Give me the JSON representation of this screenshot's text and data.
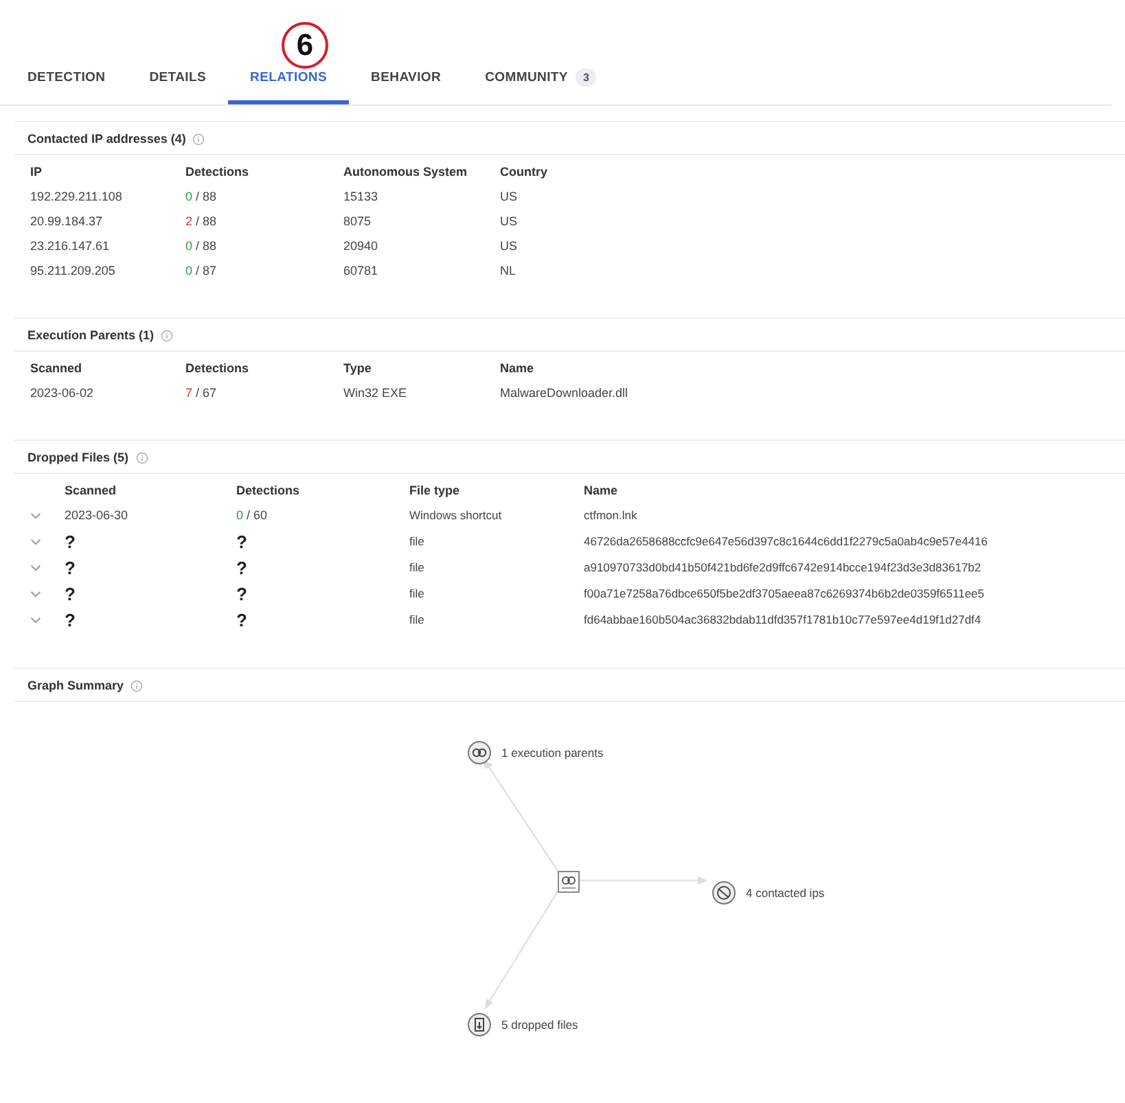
{
  "annotation": {
    "label": "6"
  },
  "tabs": [
    {
      "label": "DETECTION",
      "selected": false
    },
    {
      "label": "DETAILS",
      "selected": false
    },
    {
      "label": "RELATIONS",
      "selected": true
    },
    {
      "label": "BEHAVIOR",
      "selected": false
    },
    {
      "label": "COMMUNITY",
      "selected": false,
      "count": "3"
    }
  ],
  "contacted_ips": {
    "title": "Contacted IP addresses",
    "count": "(4)",
    "columns": [
      "IP",
      "Detections",
      "Autonomous System",
      "Country"
    ],
    "rows": [
      {
        "ip": "192.229.211.108",
        "positives": "0",
        "total": "/ 88",
        "flagged": false,
        "as": "15133",
        "country": "US"
      },
      {
        "ip": "20.99.184.37",
        "positives": "2",
        "total": "/ 88",
        "flagged": true,
        "as": "8075",
        "country": "US"
      },
      {
        "ip": "23.216.147.61",
        "positives": "0",
        "total": "/ 88",
        "flagged": false,
        "as": "20940",
        "country": "US"
      },
      {
        "ip": "95.211.209.205",
        "positives": "0",
        "total": "/ 87",
        "flagged": false,
        "as": "60781",
        "country": "NL"
      }
    ]
  },
  "execution_parents": {
    "title": "Execution Parents",
    "count": "(1)",
    "columns": [
      "Scanned",
      "Detections",
      "Type",
      "Name"
    ],
    "rows": [
      {
        "scanned": "2023-06-02",
        "positives": "7",
        "total": "/ 67",
        "flagged": true,
        "type": "Win32 EXE",
        "name": "MalwareDownloader.dll"
      }
    ]
  },
  "dropped_files": {
    "title": "Dropped Files",
    "count": "(5)",
    "columns": [
      "Scanned",
      "Detections",
      "File type",
      "Name"
    ],
    "rows": [
      {
        "kind": "known",
        "scanned": "2023-06-30",
        "positives": "0",
        "total": "/ 60",
        "flagged": false,
        "type": "Windows shortcut",
        "name": "ctfmon.lnk"
      },
      {
        "kind": "unknown",
        "scanned": "?",
        "detections": "?",
        "type": "file",
        "name": "46726da2658688ccfc9e647e56d397c8c1644c6dd1f2279c5a0ab4c9e57e4416"
      },
      {
        "kind": "unknown",
        "scanned": "?",
        "detections": "?",
        "type": "file",
        "name": "a910970733d0bd41b50f421bd6fe2d9ffc6742e914bcce194f23d3e3d83617b2"
      },
      {
        "kind": "unknown",
        "scanned": "?",
        "detections": "?",
        "type": "file",
        "name": "f00a71e7258a76dbce650f5be2df3705aeea87c6269374b6b2de0359f6511ee5"
      },
      {
        "kind": "unknown",
        "scanned": "?",
        "detections": "?",
        "type": "file",
        "name": "fd64abbae160b504ac36832bdab11dfd357f1781b10c77e597ee4d19f1d27df4"
      }
    ]
  },
  "graph_summary": {
    "title": "Graph Summary",
    "nodes": [
      {
        "kind": "parents",
        "label": "1 execution parents"
      },
      {
        "kind": "ips",
        "label": "4 contacted ips"
      },
      {
        "kind": "dropped",
        "label": "5 dropped files"
      }
    ]
  }
}
